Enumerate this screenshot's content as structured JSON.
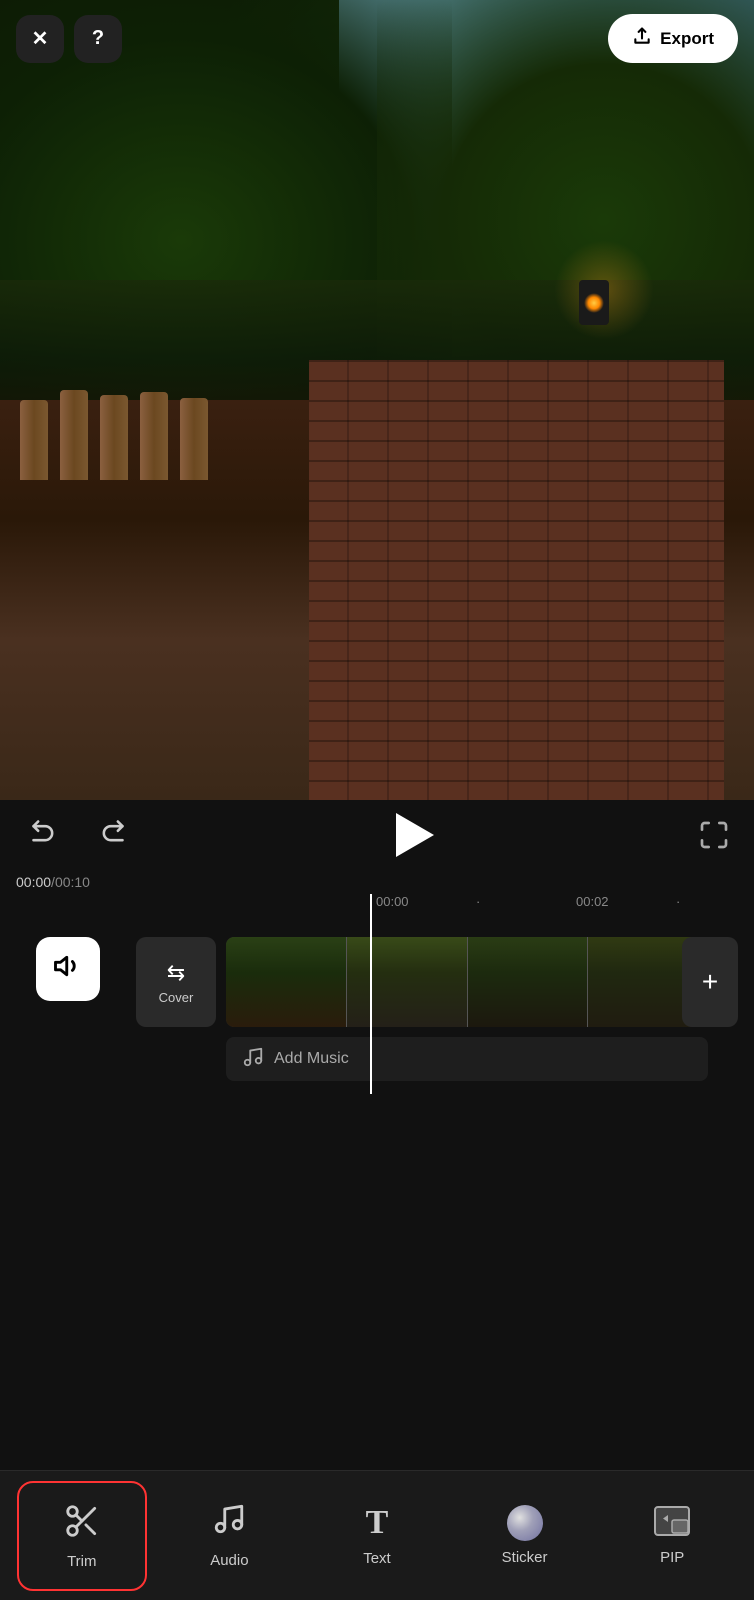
{
  "topBar": {
    "closeLabel": "✕",
    "helpLabel": "?",
    "exportLabel": "Export"
  },
  "controls": {
    "undoLabel": "↺",
    "redoLabel": "↻",
    "playLabel": "▶",
    "fullscreenLabel": "⛶"
  },
  "timeDisplay": {
    "current": "00:00",
    "separator": " / ",
    "total": "00:10"
  },
  "timeline": {
    "markers": [
      "00:00",
      "00:02"
    ],
    "coverLabel": "Cover",
    "addMusicLabel": "Add Music"
  },
  "toolbar": {
    "items": [
      {
        "id": "trim",
        "label": "Trim",
        "icon": "scissors",
        "active": true
      },
      {
        "id": "audio",
        "label": "Audio",
        "icon": "note"
      },
      {
        "id": "text",
        "label": "Text",
        "icon": "text-t"
      },
      {
        "id": "sticker",
        "label": "Sticker",
        "icon": "sticker"
      },
      {
        "id": "pip",
        "label": "PIP",
        "icon": "pip"
      }
    ]
  }
}
